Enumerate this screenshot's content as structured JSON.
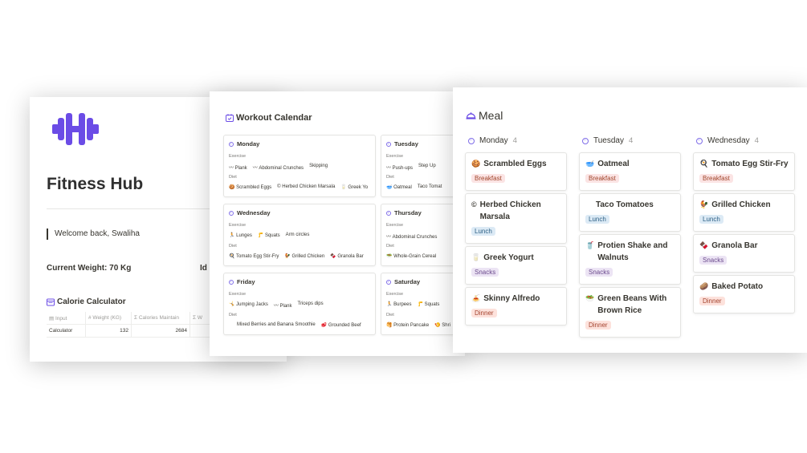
{
  "hub": {
    "title": "Fitness Hub",
    "welcome": "Welcome back, Swaliha",
    "weight": "Current Weight: 70 Kg",
    "ideal_prefix": "Id",
    "calc_title": "Calorie Calculator",
    "table": {
      "headers": [
        "Input",
        "Weight (KG)",
        "Calories Maintain",
        "W"
      ],
      "row": [
        "Calculator",
        "132",
        "2684",
        ""
      ]
    },
    "accent": "#6b4ce6"
  },
  "workout": {
    "title": "Workout Calendar",
    "exercise_label": "Exercise",
    "diet_label": "Diet",
    "days": [
      {
        "day": "Monday",
        "exercise": [
          "〰 Plank",
          "〰 Abdominal Crunches",
          "Skipping"
        ],
        "diet": [
          "🍪 Scrambled Eggs",
          "© Herbed Chicken Marsala",
          "🥛 Greek Yo"
        ]
      },
      {
        "day": "Tuesday",
        "exercise": [
          "〰 Push-ups",
          "Step Up"
        ],
        "diet": [
          "🥣 Oatmeal",
          "Taco Tomat"
        ]
      },
      {
        "day": "Wednesday",
        "exercise": [
          "🏃 Lunges",
          "🦵 Squats",
          "Arm circles"
        ],
        "diet": [
          "🍳 Tomato Egg Stir-Fry",
          "🐓 Grilled Chicken",
          "🍫 Granola Bar"
        ]
      },
      {
        "day": "Thursday",
        "exercise": [
          "〰 Abdominal Crunches"
        ],
        "diet": [
          "🥗 Whole-Grain Cereal"
        ]
      },
      {
        "day": "Friday",
        "exercise": [
          "🤸 Jumping Jacks",
          "〰 Plank",
          "Triceps dips"
        ],
        "diet": [
          "Mixed Berries and Banana Smoothie",
          "🥩 Grounded Beef"
        ]
      },
      {
        "day": "Saturday",
        "exercise": [
          "🏃 Burpees",
          "🦵 Squats"
        ],
        "diet": [
          "🥞 Protein Pancake",
          "🍤 Shri"
        ]
      }
    ]
  },
  "meal": {
    "title": "Meal",
    "columns": [
      {
        "day": "Monday",
        "count": "4",
        "cards": [
          {
            "name": "Scrambled Eggs",
            "icon": "🍪",
            "tag": "Breakfast",
            "kind": "breakfast"
          },
          {
            "name": "Herbed Chicken Marsala",
            "icon": "©",
            "tag": "Lunch",
            "kind": "lunch"
          },
          {
            "name": "Greek Yogurt",
            "icon": "🥛",
            "tag": "Snacks",
            "kind": "snacks"
          },
          {
            "name": "Skinny Alfredo",
            "icon": "🍝",
            "tag": "Dinner",
            "kind": "dinner"
          }
        ]
      },
      {
        "day": "Tuesday",
        "count": "4",
        "cards": [
          {
            "name": "Oatmeal",
            "icon": "🥣",
            "tag": "Breakfast",
            "kind": "breakfast"
          },
          {
            "name": "Taco Tomatoes",
            "icon": "",
            "tag": "Lunch",
            "kind": "lunch"
          },
          {
            "name": "Protien Shake and Walnuts",
            "icon": "🥤",
            "tag": "Snacks",
            "kind": "snacks"
          },
          {
            "name": "Green Beans With Brown Rice",
            "icon": "🥗",
            "tag": "Dinner",
            "kind": "dinner"
          }
        ]
      },
      {
        "day": "Wednesday",
        "count": "4",
        "cards": [
          {
            "name": "Tomato Egg Stir-Fry",
            "icon": "🍳",
            "tag": "Breakfast",
            "kind": "breakfast"
          },
          {
            "name": "Grilled Chicken",
            "icon": "🐓",
            "tag": "Lunch",
            "kind": "lunch"
          },
          {
            "name": "Granola Bar",
            "icon": "🍫",
            "tag": "Snacks",
            "kind": "snacks"
          },
          {
            "name": "Baked Potato",
            "icon": "🥔",
            "tag": "Dinner",
            "kind": "dinner"
          }
        ]
      }
    ]
  }
}
